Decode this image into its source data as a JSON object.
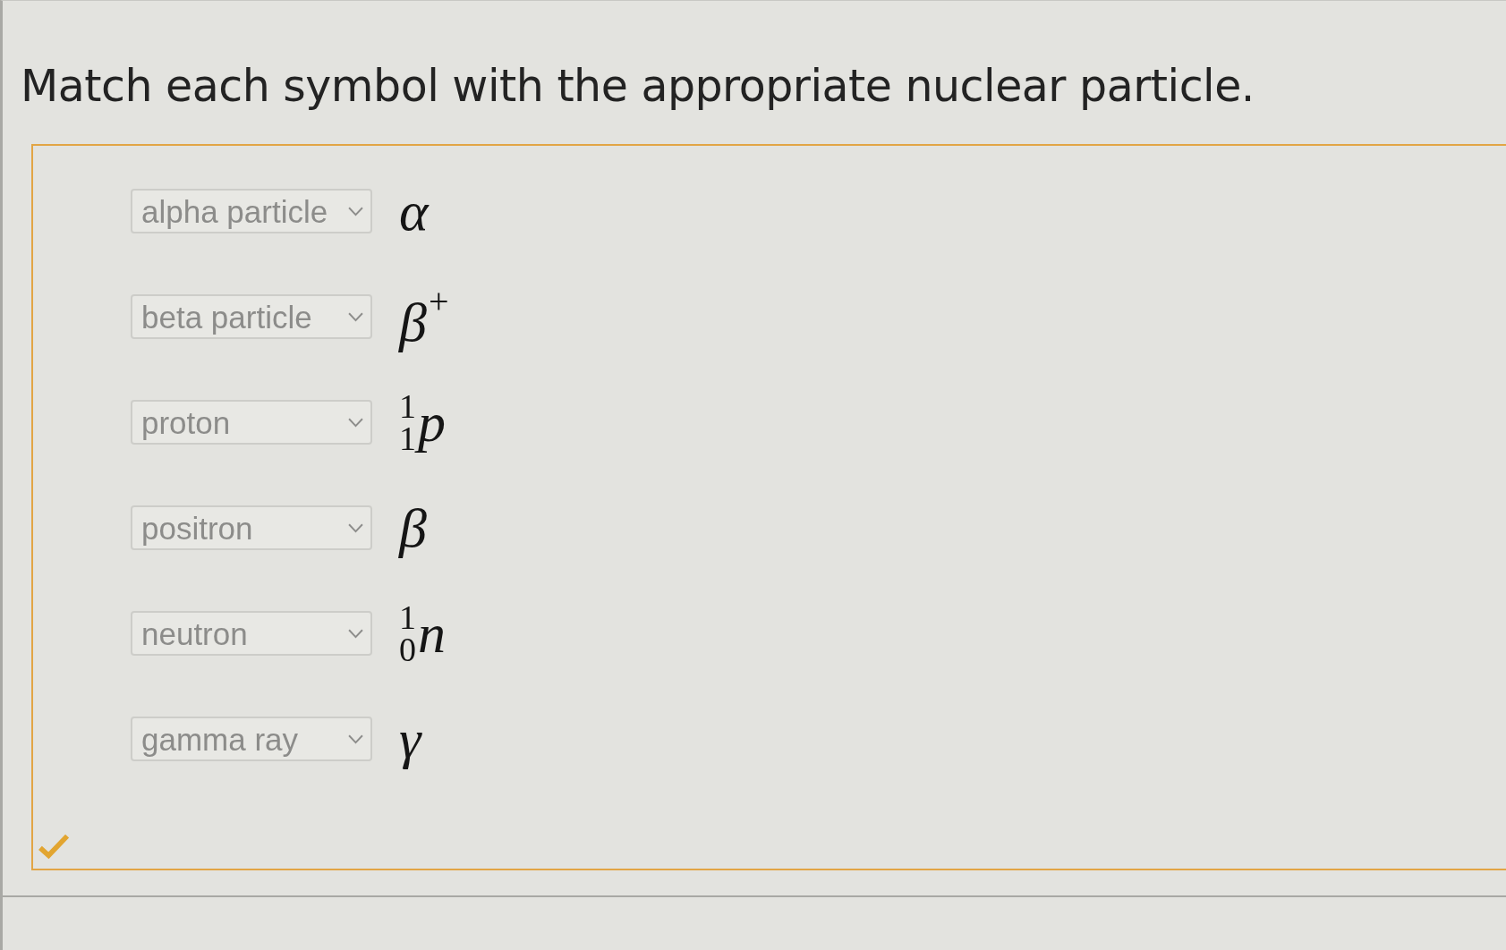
{
  "question": {
    "prompt": "Match each symbol with the appropriate nuclear particle."
  },
  "answer_area": {
    "correct": true,
    "rows": [
      {
        "dropdown": {
          "value": "alpha particle"
        },
        "symbol": {
          "letter": "α"
        }
      },
      {
        "dropdown": {
          "value": "beta particle"
        },
        "symbol": {
          "letter": "β",
          "charge": "+"
        }
      },
      {
        "dropdown": {
          "value": "proton"
        },
        "symbol": {
          "letter": "p",
          "mass_number": "1",
          "atomic_number": "1"
        }
      },
      {
        "dropdown": {
          "value": "positron"
        },
        "symbol": {
          "letter": "β"
        }
      },
      {
        "dropdown": {
          "value": "neutron"
        },
        "symbol": {
          "letter": "n",
          "mass_number": "1",
          "atomic_number": "0"
        }
      },
      {
        "dropdown": {
          "value": "gamma ray"
        },
        "symbol": {
          "letter": "γ"
        }
      }
    ]
  }
}
